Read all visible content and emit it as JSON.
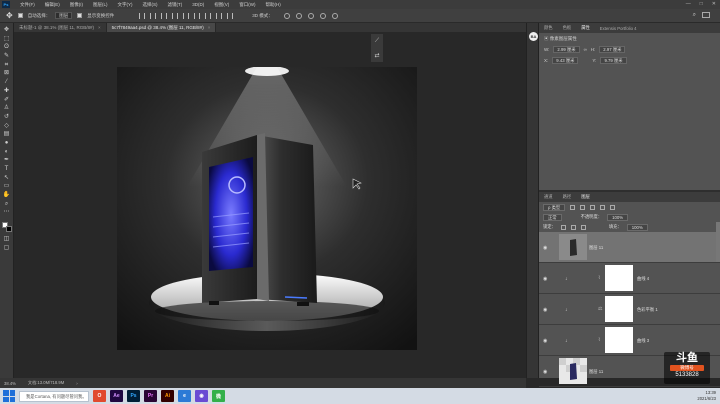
{
  "menubar": {
    "items": [
      "文件(F)",
      "编辑(E)",
      "图像(I)",
      "图层(L)",
      "文字(Y)",
      "选择(S)",
      "滤镜(T)",
      "3D(D)",
      "视图(V)",
      "窗口(W)",
      "帮助(H)"
    ],
    "window_controls": [
      "—",
      "□",
      "✕"
    ]
  },
  "options_bar": {
    "auto_select_label": "自动选择：",
    "auto_select_value": "图层",
    "show_transform_label": "显示变换控件",
    "threed_mode_label": "3D 模式："
  },
  "tabs": [
    {
      "label": "未标题-1 @ 38.1% (图层 11, RGB/8#)",
      "close": "×"
    },
    {
      "label": "5c7f7849aa4.psd @ 38.4% (图层 11, RGB/8#)",
      "close": "×"
    }
  ],
  "properties_panel": {
    "tabs": [
      "颜色",
      "色板",
      "属性",
      "Extensis Portfolio 4"
    ],
    "active_tab": "属性",
    "header": "像素图层属性",
    "w_label": "W:",
    "w_value": "2.99 厘米",
    "h_label": "H:",
    "h_value": "2.97 厘米",
    "x_label": "X:",
    "x_value": "9.43 厘米",
    "y_label": "Y:",
    "y_value": "9.79 厘米"
  },
  "layers_panel": {
    "tabs": [
      "通道",
      "路径",
      "图层"
    ],
    "active_tab": "图层",
    "filter_label": "ρ 类型",
    "blend_mode": "正常",
    "opacity_label": "不透明度：",
    "opacity_value": "100%",
    "lock_label": "锁定：",
    "fill_label": "填充：",
    "fill_value": "100%",
    "layers": [
      {
        "name": "图层 11",
        "selected": true
      },
      {
        "name": "曲线 4",
        "selected": false
      },
      {
        "name": "色彩平衡 1",
        "selected": false
      },
      {
        "name": "曲线 3",
        "selected": false
      },
      {
        "name": "图层 11",
        "selected": false
      }
    ]
  },
  "right_strip": {
    "badge": "BA"
  },
  "status_bar": {
    "zoom": "38.4%",
    "doc": "文档:13.0M/718.9M",
    "arrow": "›"
  },
  "taskbar": {
    "search_placeholder": "我是Cortana, 有问题尽管问我。",
    "apps": [
      {
        "label": "O",
        "color": "#e14a2e"
      },
      {
        "label": "Ae",
        "color": "#1f0740"
      },
      {
        "label": "Ps",
        "color": "#001e36"
      },
      {
        "label": "Pr",
        "color": "#2a0634"
      },
      {
        "label": "Ai",
        "color": "#330000"
      },
      {
        "label": "e",
        "color": "#2c7ad6"
      },
      {
        "label": "◉",
        "color": "#6a4bd3"
      },
      {
        "label": "微",
        "color": "#33b04a"
      }
    ],
    "tray_time": "13:39",
    "tray_date": "2021/6/23"
  },
  "watermark": {
    "logo": "斗鱼",
    "sub": "微博号",
    "number": "5133828"
  },
  "colors": {
    "app_bg": "#282828",
    "panel_bg": "#535353",
    "accent_blue": "#31a8ff",
    "selected_layer": "#737373"
  }
}
